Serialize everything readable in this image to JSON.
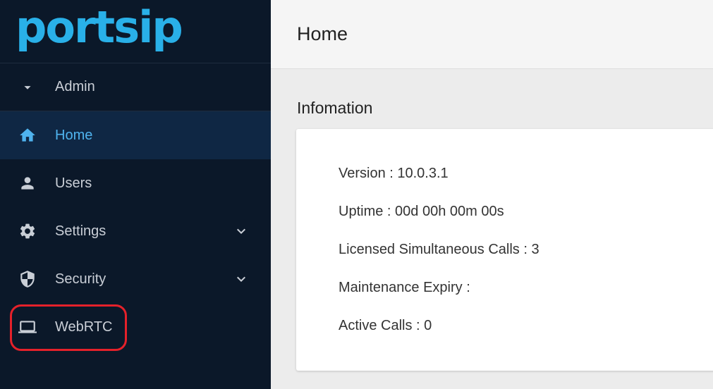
{
  "logo": {
    "text": "portsip"
  },
  "sidebar": {
    "admin_label": "Admin",
    "items": [
      {
        "label": "Home",
        "icon": "home-icon",
        "active": true
      },
      {
        "label": "Users",
        "icon": "user-icon"
      },
      {
        "label": "Settings",
        "icon": "gear-icon",
        "expandable": true
      },
      {
        "label": "Security",
        "icon": "shield-icon",
        "expandable": true
      },
      {
        "label": "WebRTC",
        "icon": "laptop-icon"
      }
    ]
  },
  "header": {
    "title": "Home"
  },
  "info": {
    "title": "Infomation",
    "lines": [
      "Version : 10.0.3.1",
      "Uptime : 00d 00h 00m 00s",
      "Licensed Simultaneous Calls : 3",
      "Maintenance Expiry :",
      "Active Calls : 0"
    ]
  },
  "colors": {
    "sidebar_bg": "#0b1829",
    "active_bg": "#0f2744",
    "accent": "#4fb3ee",
    "logo": "#29b0e8",
    "highlight": "#e5212a"
  }
}
